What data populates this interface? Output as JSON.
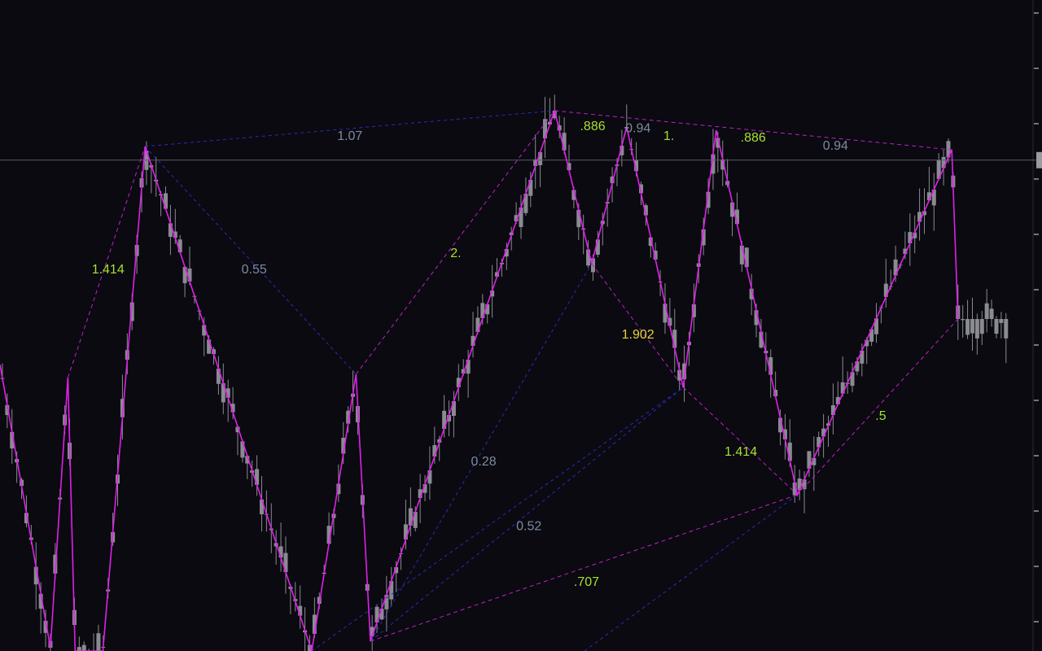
{
  "colors": {
    "background": "#0a0a10",
    "candle": "#8a8a92",
    "zigzag": "#e020e8",
    "pattern_dashed": "#c020c8",
    "retracement_dashed": "#2b2bbf",
    "label_green": "#a8e030",
    "label_yellow": "#e8d23a",
    "label_gray": "#7d8aa0",
    "price_line": "#5a5a66",
    "axis": "#e0e0e0"
  },
  "chart_data": {
    "type": "candlestick",
    "title": "",
    "xlabel": "",
    "ylabel": "",
    "xlim": [
      0,
      100
    ],
    "ylim": [
      0,
      100
    ],
    "grid": false,
    "current_price": 75.4,
    "candles": [],
    "zigzag": [
      {
        "x": 0,
        "y": 44
      },
      {
        "x": 4.9,
        "y": 0.5
      },
      {
        "x": 6.6,
        "y": 42
      },
      {
        "x": 7.3,
        "y": 0
      },
      {
        "x": 10.0,
        "y": 0
      },
      {
        "x": 14.1,
        "y": 77.5
      },
      {
        "x": 30.3,
        "y": 0
      },
      {
        "x": 34.6,
        "y": 42.5
      },
      {
        "x": 36.0,
        "y": 1.5
      },
      {
        "x": 53.9,
        "y": 83
      },
      {
        "x": 57.5,
        "y": 59.5
      },
      {
        "x": 60.9,
        "y": 80.5
      },
      {
        "x": 66.4,
        "y": 40.5
      },
      {
        "x": 69.6,
        "y": 80
      },
      {
        "x": 77.5,
        "y": 24
      },
      {
        "x": 92.5,
        "y": 77
      },
      {
        "x": 93.1,
        "y": 51
      }
    ],
    "harmonic_legs": [
      {
        "from": [
          6.6,
          42
        ],
        "to": [
          14.1,
          77.5
        ],
        "style": "pattern"
      },
      {
        "from": [
          14.1,
          77.5
        ],
        "to": [
          34.6,
          42.5
        ],
        "style": "retracement"
      },
      {
        "from": [
          34.6,
          42.5
        ],
        "to": [
          53.9,
          83
        ],
        "style": "pattern"
      },
      {
        "from": [
          14.1,
          77.5
        ],
        "to": [
          53.9,
          83
        ],
        "style": "retracement"
      },
      {
        "from": [
          53.9,
          83
        ],
        "to": [
          92.5,
          77
        ],
        "style": "pattern"
      },
      {
        "from": [
          57.5,
          59.5
        ],
        "to": [
          66.4,
          40.5
        ],
        "style": "pattern"
      },
      {
        "from": [
          66.4,
          40.5
        ],
        "to": [
          77.5,
          24
        ],
        "style": "pattern"
      },
      {
        "from": [
          77.5,
          24
        ],
        "to": [
          93.1,
          51
        ],
        "style": "pattern"
      },
      {
        "from": [
          36.0,
          1.5
        ],
        "to": [
          57.5,
          59.5
        ],
        "style": "retracement"
      },
      {
        "from": [
          36.0,
          1.5
        ],
        "to": [
          66.4,
          40.5
        ],
        "style": "retracement"
      },
      {
        "from": [
          30.3,
          0
        ],
        "to": [
          66.4,
          40.5
        ],
        "style": "retracement"
      },
      {
        "from": [
          36.0,
          1.5
        ],
        "to": [
          77.5,
          24
        ],
        "style": "pattern"
      },
      {
        "from": [
          56.8,
          0
        ],
        "to": [
          77.5,
          24
        ],
        "style": "retracement"
      }
    ],
    "annotations": [
      {
        "text": "1.414",
        "x": 10.5,
        "y": 58.5,
        "color": "label_green"
      },
      {
        "text": "1.07",
        "x": 34.0,
        "y": 79,
        "color": "label_gray"
      },
      {
        "text": "0.55",
        "x": 24.7,
        "y": 58.5,
        "color": "label_gray"
      },
      {
        "text": "2.",
        "x": 44.3,
        "y": 61,
        "color": "label_green"
      },
      {
        "text": ".886",
        "x": 57.6,
        "y": 80.5,
        "color": "label_green"
      },
      {
        "text": "0.94",
        "x": 62.0,
        "y": 80.2,
        "color": "label_gray"
      },
      {
        "text": "1.",
        "x": 65.0,
        "y": 79,
        "color": "label_green"
      },
      {
        "text": ".886",
        "x": 73.2,
        "y": 78.8,
        "color": "label_green"
      },
      {
        "text": "0.94",
        "x": 81.2,
        "y": 77.5,
        "color": "label_gray"
      },
      {
        "text": "1.902",
        "x": 62.0,
        "y": 48.5,
        "color": "label_yellow"
      },
      {
        "text": "0.28",
        "x": 47.0,
        "y": 29,
        "color": "label_gray"
      },
      {
        "text": "0.52",
        "x": 51.4,
        "y": 19.1,
        "color": "label_gray"
      },
      {
        "text": "1.414",
        "x": 72.0,
        "y": 30.5,
        "color": "label_green"
      },
      {
        "text": ".5",
        "x": 85.6,
        "y": 36,
        "color": "label_green"
      },
      {
        "text": ".707",
        "x": 57.0,
        "y": 10.5,
        "color": "label_green"
      }
    ],
    "axis_ticks": [
      98,
      89.5,
      81,
      72.5,
      64,
      55.5,
      47,
      38.5,
      30,
      21.5,
      13,
      4.5
    ]
  }
}
